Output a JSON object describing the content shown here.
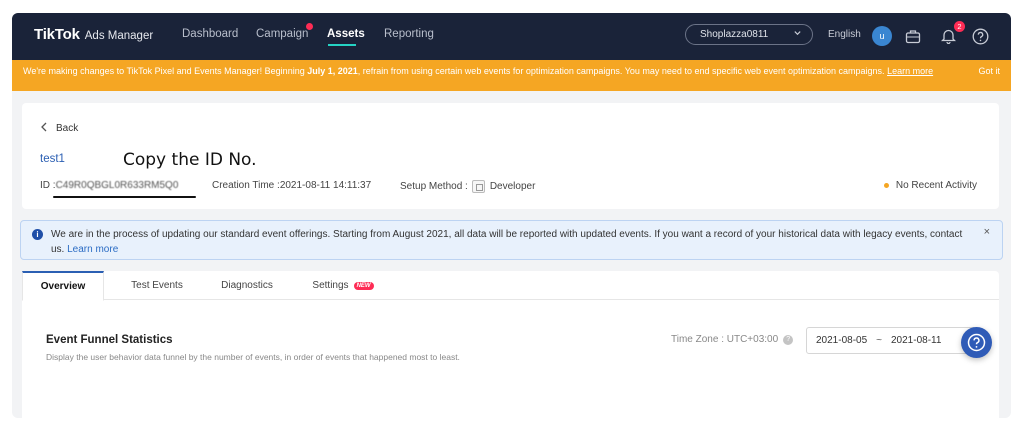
{
  "nav": {
    "logo_main": "TikTok",
    "logo_sub": "Ads Manager",
    "items": [
      "Dashboard",
      "Campaign",
      "Assets",
      "Reporting"
    ],
    "active": "Assets",
    "account": "Shoplazza0811",
    "language": "English",
    "avatar_initial": "u",
    "notification_count": "2"
  },
  "banner": {
    "text_before": "We're making changes to TikTok Pixel and Events Manager! Beginning ",
    "date": "July 1, 2021",
    "text_after": ", refrain from using certain web events for optimization campaigns. You may need to end specific web event optimization campaigns. ",
    "link": "Learn more",
    "dismiss": "Got it"
  },
  "header": {
    "back_label": "Back",
    "pixel_name": "test1",
    "annotation": "Copy the ID No.",
    "id_label": "ID : ",
    "id_value": "C49R0QBGL0R633RM5Q0",
    "creation_label": "Creation Time : ",
    "creation_value": "2021-08-11 14:11:37",
    "setup_label": "Setup Method : ",
    "setup_value": "Developer",
    "status": "No Recent Activity"
  },
  "notice": {
    "text": "We are in the process of updating our standard event offerings. Starting from August 2021, all data will be reported with updated events. If you want a record of your historical data with legacy events, contact us. ",
    "link": "Learn more",
    "close": "×"
  },
  "tabs": {
    "items": [
      "Overview",
      "Test Events",
      "Diagnostics",
      "Settings"
    ],
    "new_badge": "NEW"
  },
  "funnel": {
    "title": "Event Funnel Statistics",
    "description": "Display the user behavior data funnel by the number of events, in order of events that happened most to least.",
    "timezone": "Time Zone : UTC+03:00",
    "date_start": "2021-08-05",
    "date_sep": "~",
    "date_end": "2021-08-11"
  },
  "colors": {
    "nav_bg": "#1a2339",
    "banner_bg": "#f5a623",
    "accent_blue": "#2b5fb3",
    "badge_red": "#fe2c55"
  }
}
